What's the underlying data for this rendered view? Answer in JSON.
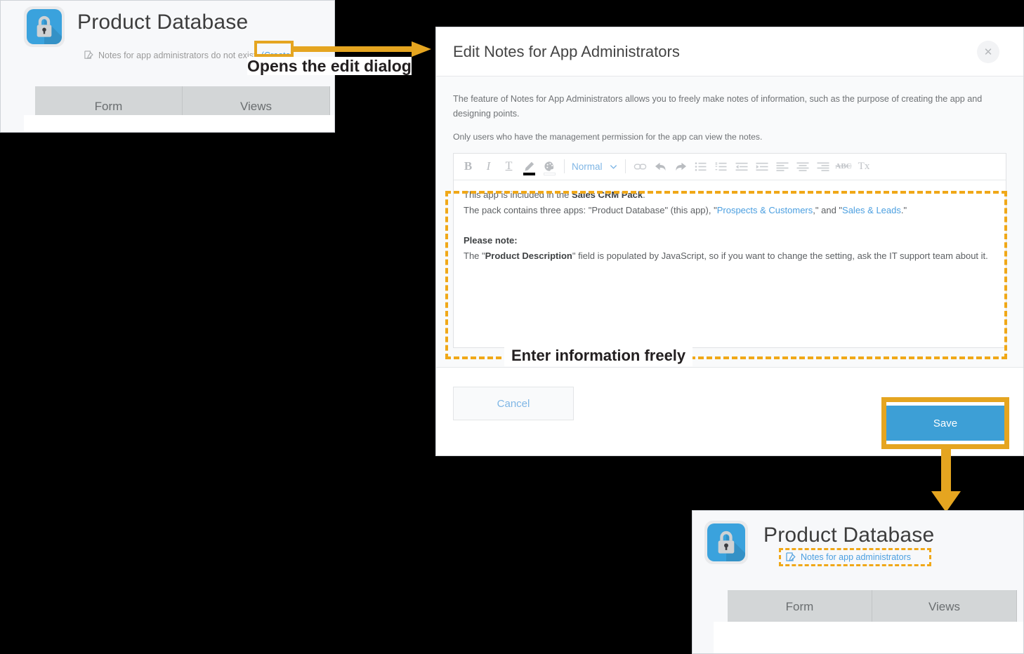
{
  "colors": {
    "accent_orange": "#e5a520",
    "dashed_orange": "#f0a818",
    "link_blue": "#4b9fe0",
    "save_blue": "#3d9fd6",
    "app_icon_blue": "#3aa2dd",
    "tab_gray": "#d3d6d7"
  },
  "app_panel_before": {
    "title": "Product Database",
    "notes_icon": "notes-edit-icon",
    "notes_text": "Notes for app administrators do not exist.",
    "create_link": "(Create)",
    "tabs": [
      "Form",
      "Views"
    ]
  },
  "app_panel_after": {
    "title": "Product Database",
    "notes_icon": "notes-edit-icon",
    "notes_link": "Notes for app administrators",
    "tabs": [
      "Form",
      "Views"
    ]
  },
  "dialog": {
    "title": "Edit Notes for App Administrators",
    "close_icon": "close-icon",
    "description_1": "The feature of Notes for App Administrators allows you to freely make notes of information, such as the purpose of creating the app and designing points.",
    "description_2": "Only users who have the management permission for the app can view the notes.",
    "toolbar": {
      "bold": "B",
      "italic": "I",
      "underline": "T",
      "text_color_icon": "pencil-icon",
      "background_color_icon": "palette-icon",
      "style_select": "Normal",
      "chevron_icon": "chevron-down-icon",
      "link_icon": "link-icon",
      "undo_icon": "undo-icon",
      "redo_icon": "redo-icon",
      "bullet_list_icon": "bullet-list-icon",
      "numbered_list_icon": "numbered-list-icon",
      "outdent_icon": "decrease-indent-icon",
      "indent_icon": "increase-indent-icon",
      "align_left_icon": "align-left-icon",
      "align_center_icon": "align-center-icon",
      "align_right_icon": "align-right-icon",
      "strikethrough_label": "ABC",
      "remove_format_label": "Tx"
    },
    "editor": {
      "line1_a": "This app is included in the ",
      "line1_b": "Sales CRM Pack",
      "line1_c": ".",
      "line2_a": "The pack contains three apps: \"Product Database\" (this app), \"",
      "line2_link1": "Prospects & Customers",
      "line2_b": ",\" and \"",
      "line2_link2": "Sales & Leads",
      "line2_c": ".\"",
      "line3": "Please note:",
      "line4_a": "The \"",
      "line4_b": "Product Description",
      "line4_c": "\" field is populated by JavaScript, so if you want to change the setting, ask the IT support team about it."
    },
    "cancel_label": "Cancel",
    "save_label": "Save"
  },
  "annotations": {
    "opens_dialog": "Opens the edit dialog",
    "enter_freely": "Enter information freely"
  }
}
